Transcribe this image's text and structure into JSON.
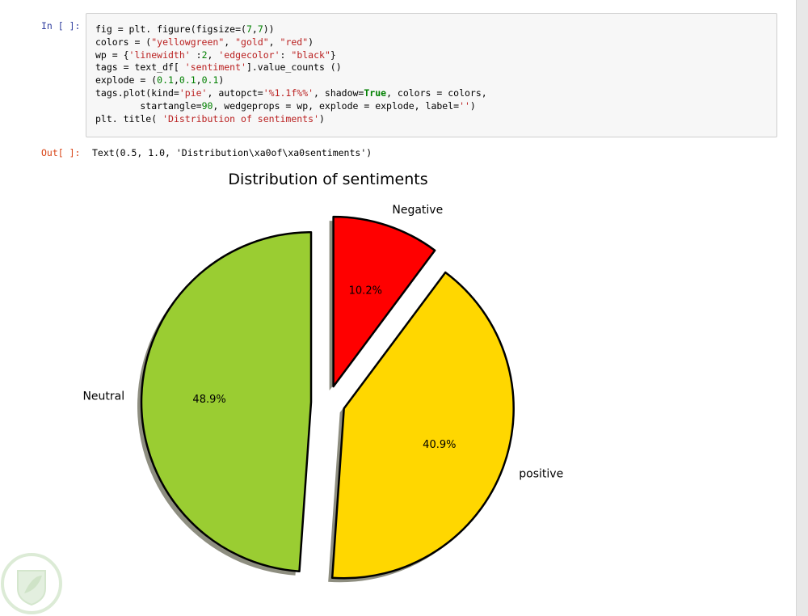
{
  "notebook": {
    "in_prompt": "In [ ]:",
    "out_prompt": "Out[ ]:",
    "code_lines": [
      [
        [
          "fig = plt. figure(figsize=(",
          ""
        ],
        [
          "7",
          "num"
        ],
        [
          ",",
          ""
        ],
        [
          "7",
          "num"
        ],
        [
          "))",
          ""
        ]
      ],
      [
        [
          "colors = (",
          ""
        ],
        [
          "\"yellowgreen\"",
          "str"
        ],
        [
          ", ",
          ""
        ],
        [
          "\"gold\"",
          "str"
        ],
        [
          ", ",
          ""
        ],
        [
          "\"red\"",
          "str"
        ],
        [
          ")",
          ""
        ]
      ],
      [
        [
          "wp = {",
          ""
        ],
        [
          "'linewidth'",
          "str"
        ],
        [
          " :",
          ""
        ],
        [
          "2",
          "num"
        ],
        [
          ", ",
          ""
        ],
        [
          "'edgecolor'",
          "str"
        ],
        [
          ": ",
          ""
        ],
        [
          "\"black\"",
          "str"
        ],
        [
          "}",
          ""
        ]
      ],
      [
        [
          "tags = text_df[ ",
          ""
        ],
        [
          "'sentiment'",
          "str"
        ],
        [
          "].value_counts ()",
          ""
        ]
      ],
      [
        [
          "explode = (",
          ""
        ],
        [
          "0.1",
          "num"
        ],
        [
          ",",
          ""
        ],
        [
          "0.1",
          "num"
        ],
        [
          ",",
          ""
        ],
        [
          "0.1",
          "num"
        ],
        [
          ")",
          ""
        ]
      ],
      [
        [
          "tags.plot(kind=",
          ""
        ],
        [
          "'pie'",
          "str"
        ],
        [
          ", autopct=",
          ""
        ],
        [
          "'%1.1f%%'",
          "str"
        ],
        [
          ", shadow=",
          ""
        ],
        [
          "True",
          "kw"
        ],
        [
          ", colors = colors,",
          ""
        ]
      ],
      [
        [
          "        startangle=",
          ""
        ],
        [
          "90",
          "num"
        ],
        [
          ", wedgeprops = wp, explode = explode, label=",
          ""
        ],
        [
          "''",
          "str"
        ],
        [
          ")",
          ""
        ]
      ],
      [
        [
          "plt. title( ",
          ""
        ],
        [
          "'Distribution of sentiments'",
          "str"
        ],
        [
          ")",
          ""
        ]
      ]
    ],
    "output_text": "Text(0.5, 1.0, 'Distribution\\xa0of\\xa0sentiments')"
  },
  "chart_data": {
    "type": "pie",
    "title": "Distribution of sentiments",
    "startangle": 90,
    "explode": [
      0.1,
      0.1,
      0.1
    ],
    "shadow": true,
    "edgecolor": "#000000",
    "slices": [
      {
        "label": "Neutral",
        "value": 48.9,
        "pct_label": "48.9%",
        "color": "#9acd32"
      },
      {
        "label": "positive",
        "value": 40.9,
        "pct_label": "40.9%",
        "color": "#ffd700"
      },
      {
        "label": "Negative",
        "value": 10.2,
        "pct_label": "10.2%",
        "color": "#ff0000"
      }
    ]
  }
}
